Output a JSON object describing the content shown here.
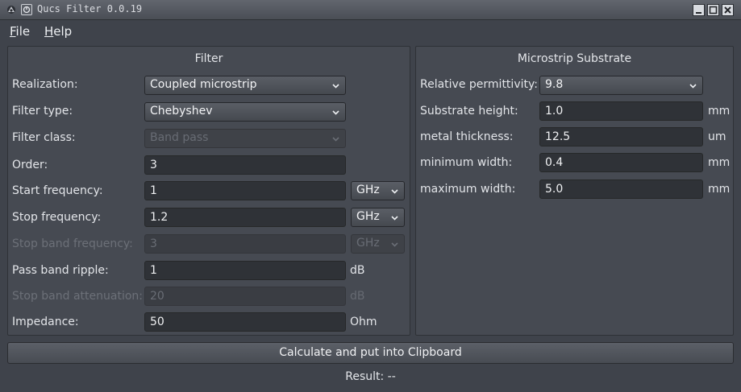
{
  "window": {
    "title": "Qucs Filter 0.0.19"
  },
  "menu": {
    "file": {
      "mnemonic": "F",
      "rest": "ile"
    },
    "help": {
      "mnemonic": "H",
      "rest": "elp"
    }
  },
  "filter_panel": {
    "title": "Filter",
    "realization": {
      "label": "Realization:",
      "value": "Coupled microstrip"
    },
    "filter_type": {
      "label": "Filter type:",
      "value": "Chebyshev"
    },
    "filter_class": {
      "label": "Filter class:",
      "value": "Band pass"
    },
    "order": {
      "label": "Order:",
      "value": "3"
    },
    "start_frequency": {
      "label": "Start frequency:",
      "value": "1",
      "unit": "GHz"
    },
    "stop_frequency": {
      "label": "Stop frequency:",
      "value": "1.2",
      "unit": "GHz"
    },
    "stop_band_frequency": {
      "label": "Stop band frequency:",
      "value": "3",
      "unit": "GHz"
    },
    "pass_band_ripple": {
      "label": "Pass band ripple:",
      "value": "1",
      "unit": "dB"
    },
    "stop_band_attenuation": {
      "label": "Stop band attenuation:",
      "value": "20",
      "unit": "dB"
    },
    "impedance": {
      "label": "Impedance:",
      "value": "50",
      "unit": "Ohm"
    }
  },
  "substrate_panel": {
    "title": "Microstrip Substrate",
    "relative_permittivity": {
      "label": "Relative permittivity:",
      "value": "9.8"
    },
    "substrate_height": {
      "label": "Substrate height:",
      "value": "1.0",
      "unit": "mm"
    },
    "metal_thickness": {
      "label": "metal thickness:",
      "value": "12.5",
      "unit": "um"
    },
    "minimum_width": {
      "label": "minimum width:",
      "value": "0.4",
      "unit": "mm"
    },
    "maximum_width": {
      "label": "maximum width:",
      "value": "5.0",
      "unit": "mm"
    }
  },
  "actions": {
    "calculate_label": "Calculate and put into Clipboard"
  },
  "status": {
    "result": "Result: --"
  },
  "icons": {
    "app": "qucs-app-icon",
    "window_menu": "window-menu-icon",
    "minimize": "minimize-icon",
    "maximize": "maximize-icon",
    "close": "close-icon",
    "combo_arrow": "chevron-down-icon"
  }
}
